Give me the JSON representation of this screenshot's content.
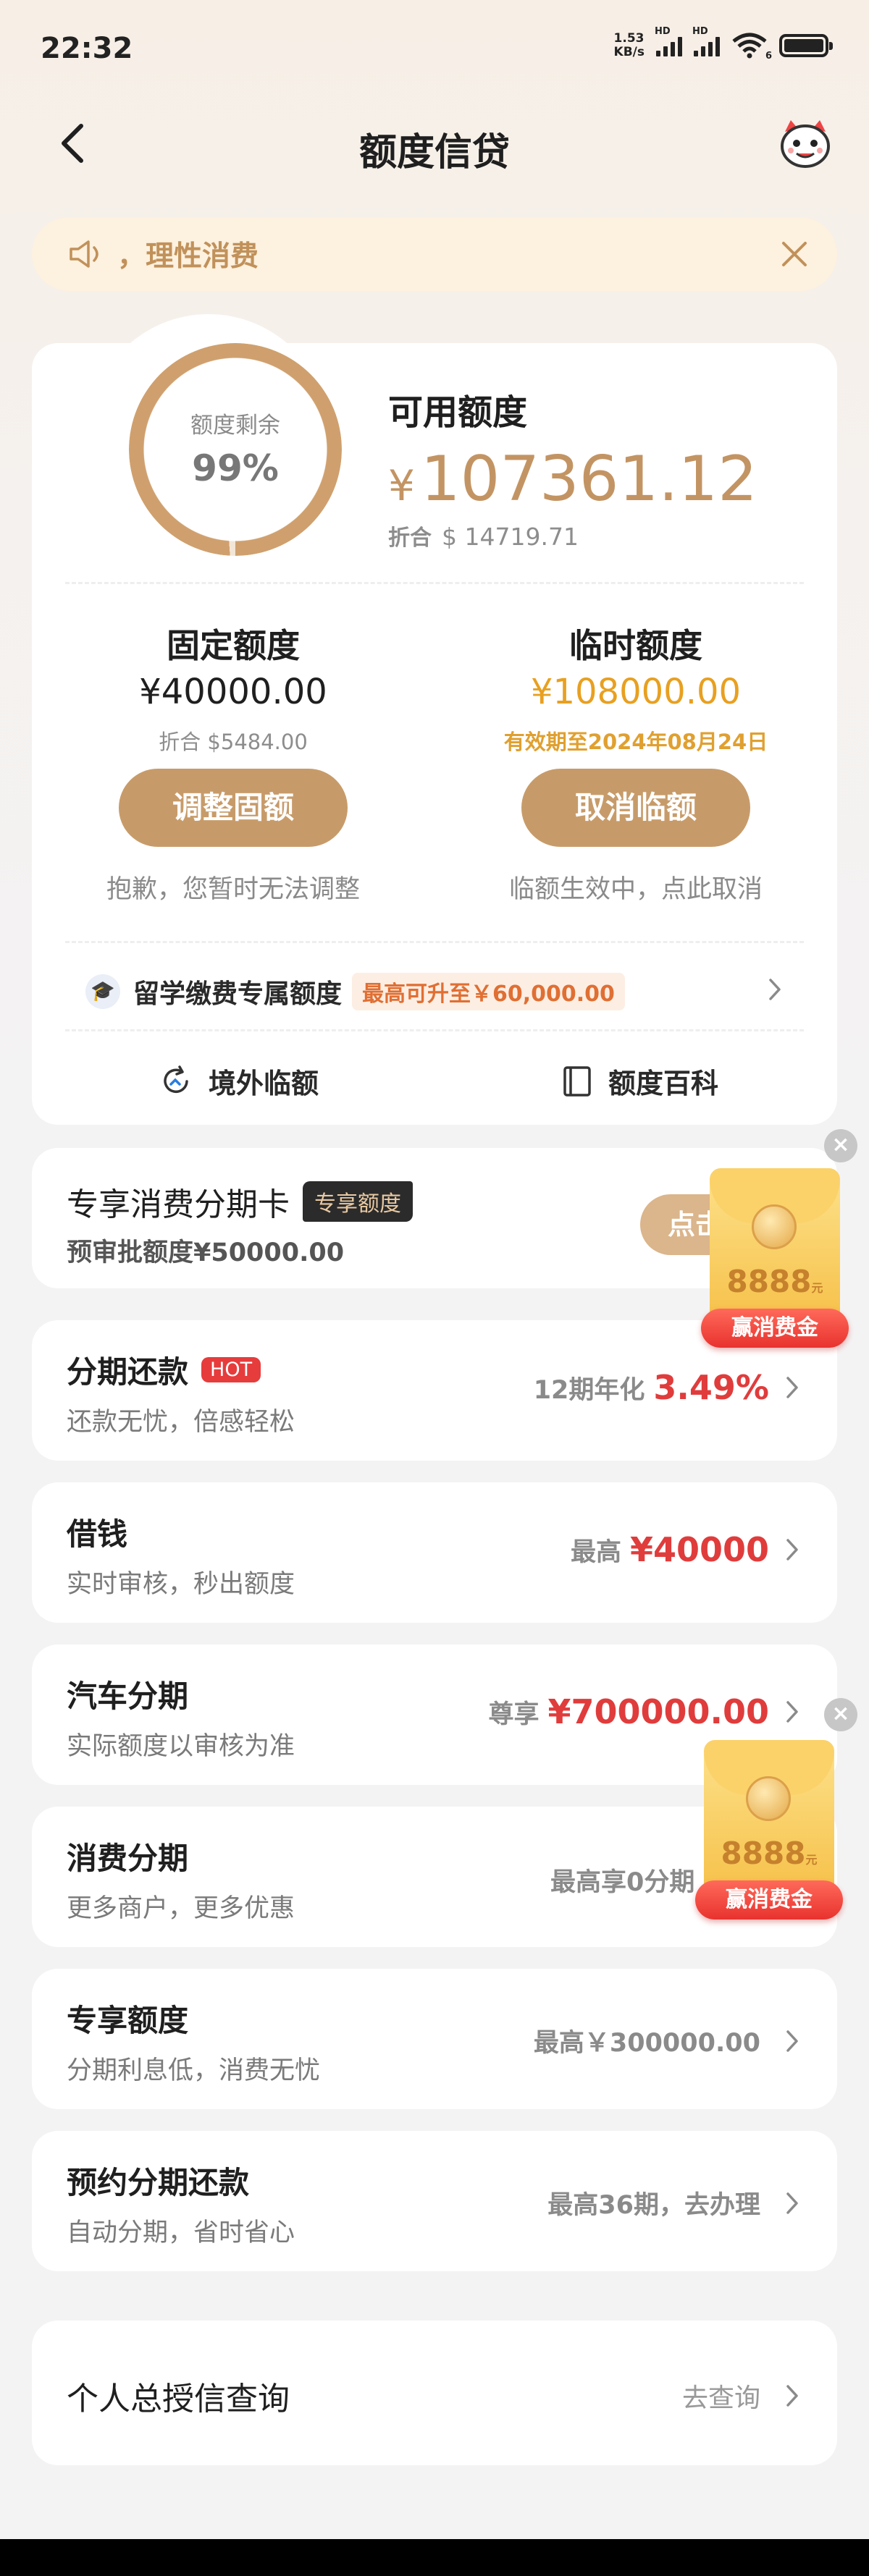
{
  "status": {
    "time": "22:32",
    "speed_top": "1.53",
    "speed_bottom": "KB/s",
    "hd1": "HD",
    "hd2": "HD",
    "wifi_num": "6"
  },
  "nav": {
    "title": "额度信贷"
  },
  "notice": {
    "text": "，理性消费"
  },
  "quota": {
    "ring_label": "额度剩余",
    "ring_value": "99%",
    "ring_fraction": 0.99,
    "available_title": "可用额度",
    "available_currency": "¥",
    "available_amount": "107361.12",
    "available_sub_label": "折合",
    "available_sub_value": "$ 14719.71",
    "fixed": {
      "title": "固定额度",
      "amount": "¥40000.00",
      "sub": "折合 $5484.00",
      "button": "调整固额",
      "note": "抱歉，您暂时无法调整"
    },
    "temp": {
      "title": "临时额度",
      "amount": "¥108000.00",
      "sub": "有效期至2024年08月24日",
      "button": "取消临额",
      "note": "临额生效中，点此取消"
    },
    "study": {
      "icon": "🎓",
      "text": "留学缴费专属额度",
      "badge": "最高可升至￥60,000.00"
    },
    "links": [
      {
        "label": "境外临额",
        "icon": "refresh-icon"
      },
      {
        "label": "额度百科",
        "icon": "book-icon"
      }
    ]
  },
  "rows": [
    {
      "title": "专享消费分期卡",
      "tag": "专享额度",
      "sub": "预审批额度¥50000.00",
      "button": "点击"
    },
    {
      "title": "分期还款",
      "tag": "HOT",
      "sub": "还款无忧，倍感轻松",
      "right_label": "12期年化",
      "right_value": "3.49%"
    },
    {
      "title": "借钱",
      "sub": "实时审核，秒出额度",
      "right_label": "最高",
      "right_value": "¥40000"
    },
    {
      "title": "汽车分期",
      "sub": "实际额度以审核为准",
      "right_label": "尊享",
      "right_value": "¥700000.00"
    },
    {
      "title": "消费分期",
      "sub": "更多商户，更多优惠",
      "right_label": "最高享0分期"
    },
    {
      "title": "专享额度",
      "sub": "分期利息低，消费无忧",
      "right_label": "最高￥300000.00"
    },
    {
      "title": "预约分期还款",
      "sub": "自动分期，省时省心",
      "right_label": "最高36期，去办理"
    }
  ],
  "credit_query": {
    "title": "个人总授信查询",
    "action": "去查询"
  },
  "envelope": {
    "amount": "8888",
    "unit": "元",
    "label": "赢消费金",
    "close": "×"
  },
  "colors": {
    "accent_gold": "#c79b69",
    "price_red": "#e03c3c",
    "temp_orange": "#e8a020"
  }
}
